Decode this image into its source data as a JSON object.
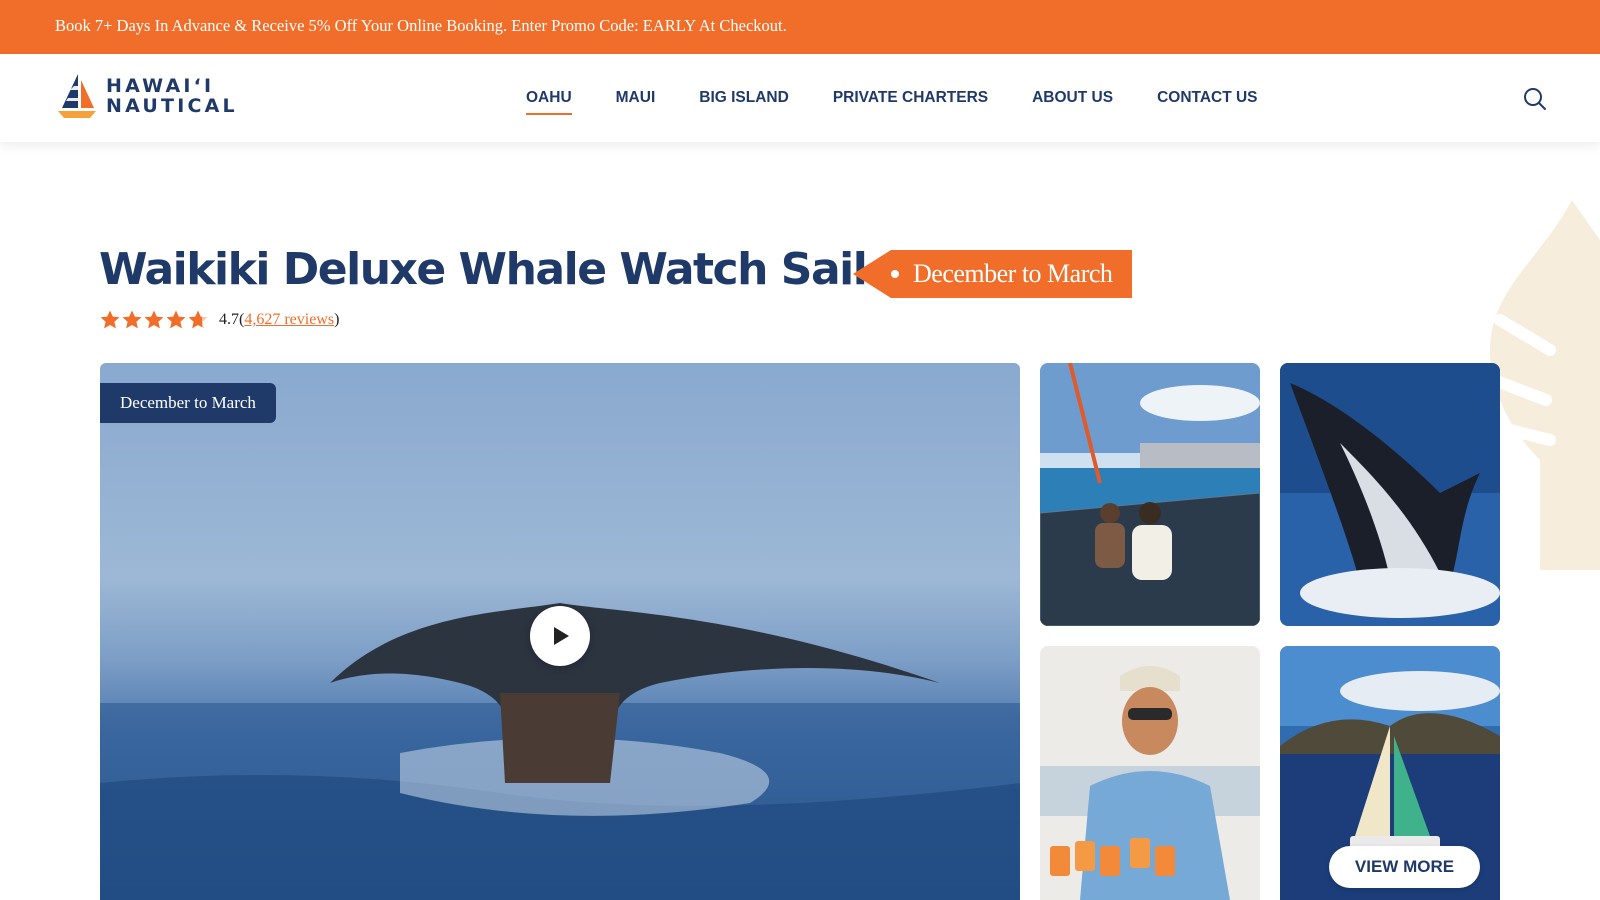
{
  "promo": {
    "text": "Book 7+ Days In Advance & Receive 5% Off Your Online Booking. Enter Promo Code: EARLY At Checkout."
  },
  "header": {
    "logo_line1": "HAWAI‘I",
    "logo_line2": "NAUTICAL",
    "nav": [
      {
        "label": "OAHU",
        "active": true
      },
      {
        "label": "MAUI"
      },
      {
        "label": "BIG ISLAND"
      },
      {
        "label": "PRIVATE CHARTERS"
      },
      {
        "label": "ABOUT US"
      },
      {
        "label": "CONTACT US"
      }
    ],
    "search_icon": "search-icon"
  },
  "tour": {
    "title": "Waikiki Deluxe Whale Watch Sail",
    "season_tag": "December to March",
    "rating_value": "4.7",
    "rating_stars": 4.7,
    "reviews_open": "(",
    "reviews_link": "4,627 reviews",
    "reviews_close": ")"
  },
  "gallery": {
    "hero_badge": "December to March",
    "play_icon": "play-icon",
    "view_more": "VIEW MORE"
  },
  "colors": {
    "accent": "#f06d2a",
    "navy": "#1f3a68"
  }
}
